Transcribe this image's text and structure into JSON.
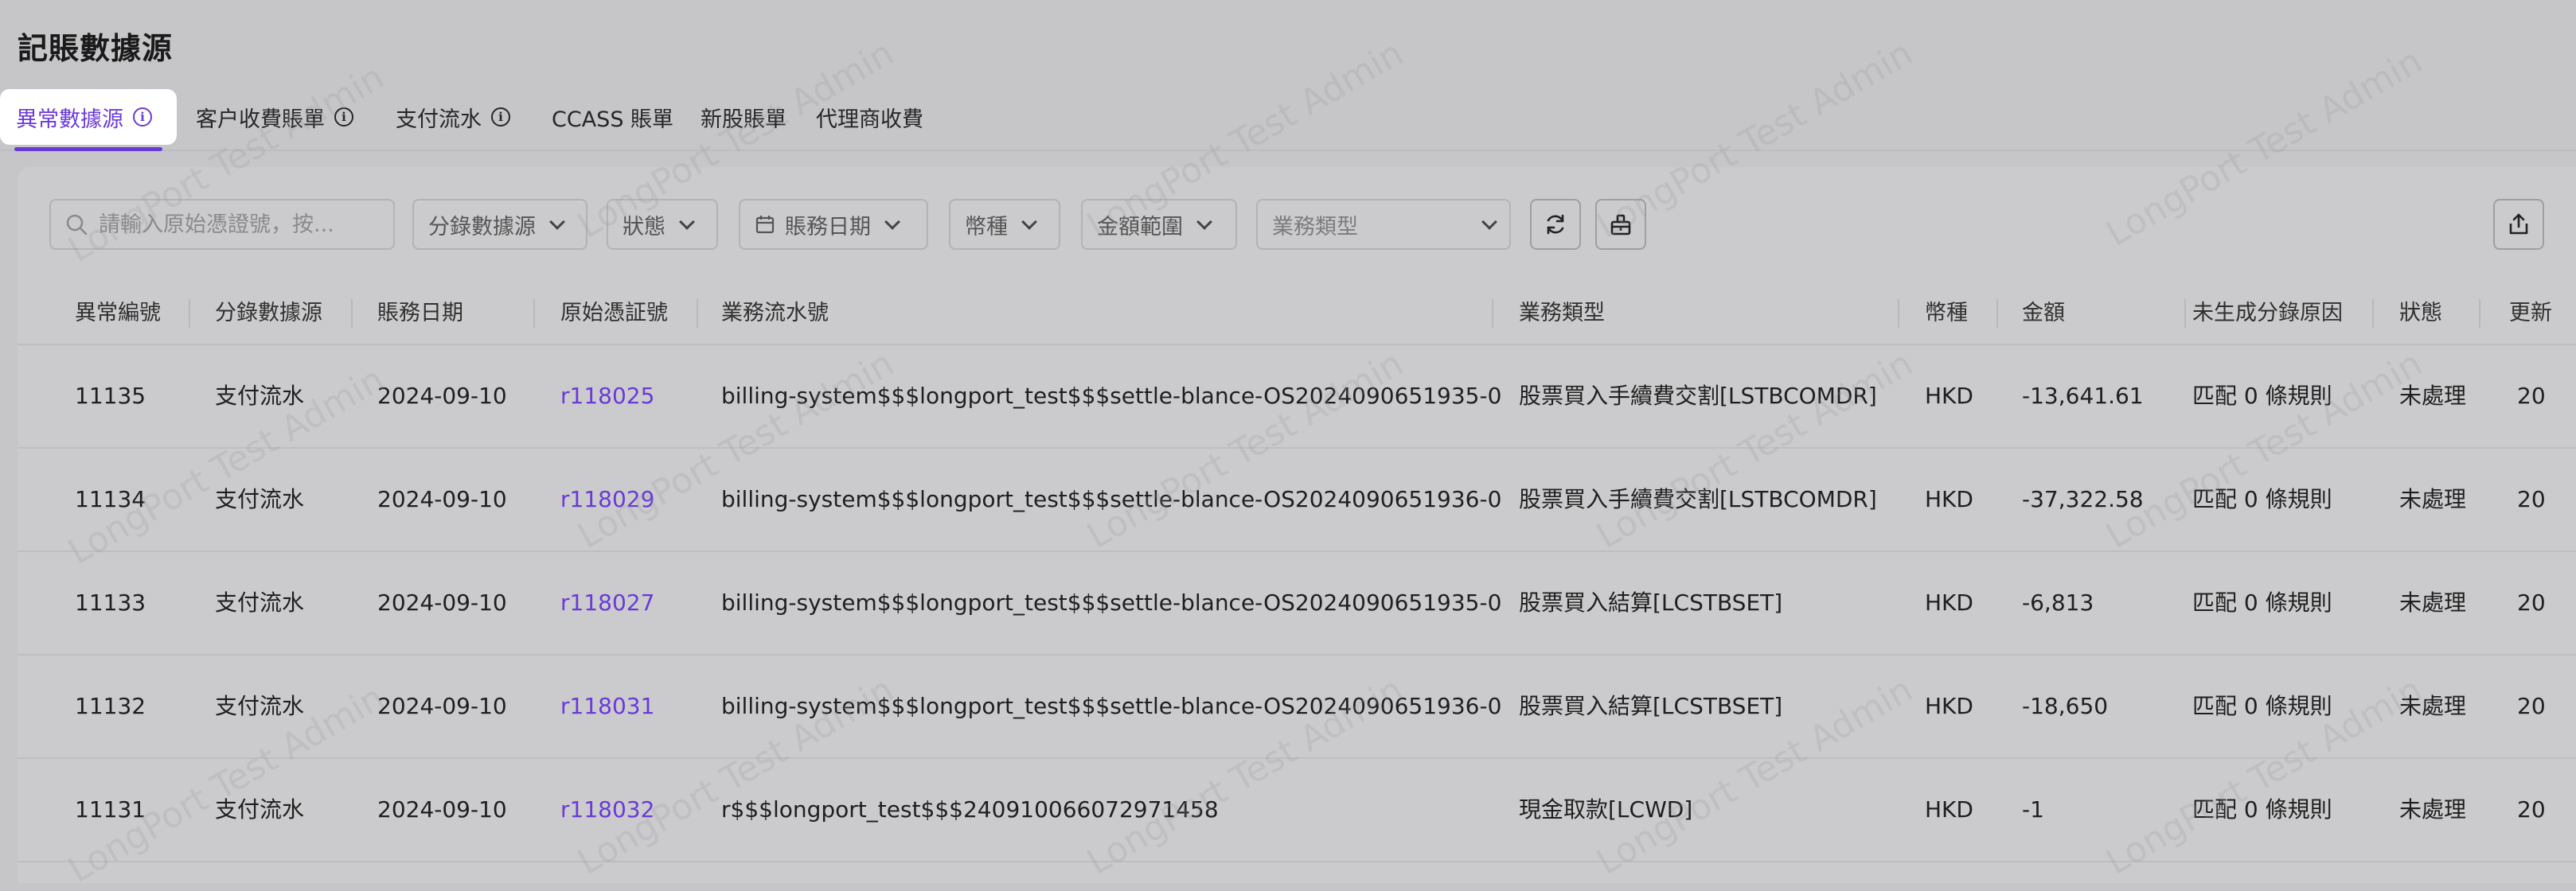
{
  "page": {
    "title": "記賬數據源"
  },
  "tabs": [
    {
      "label": "異常數據源",
      "active": true,
      "info_icon": true
    },
    {
      "label": "客户收費賬單",
      "active": false,
      "info_icon": true
    },
    {
      "label": "支付流水",
      "active": false,
      "info_icon": true
    },
    {
      "label": "CCASS 賬單",
      "active": false,
      "info_icon": false
    },
    {
      "label": "新股賬單",
      "active": false,
      "info_icon": false
    },
    {
      "label": "代理商收費",
      "active": false,
      "info_icon": false
    }
  ],
  "filters": {
    "search_placeholder": "請輸入原始憑證號，按...",
    "source": "分錄數據源",
    "status": "狀態",
    "date": "賬務日期",
    "currency": "幣種",
    "amount_range": "金額範圍",
    "business_type": "業務類型"
  },
  "table": {
    "columns": [
      "異常編號",
      "分錄數據源",
      "賬務日期",
      "原始憑証號",
      "業務流水號",
      "業務類型",
      "幣種",
      "金額",
      "未生成分錄原因",
      "狀態",
      "更新"
    ],
    "rows": [
      {
        "id": "11135",
        "source": "支付流水",
        "date": "2024-09-10",
        "voucher": "r118025",
        "flow_no": "billing-system$$$longport_test$$$settle-blance-OS2024090651935-0",
        "biz_type": "股票買入手續費交割[LSTBCOMDR]",
        "currency": "HKD",
        "amount": "-13,641.61",
        "reason": "匹配 0 條規則",
        "status": "未處理",
        "updated": "20"
      },
      {
        "id": "11134",
        "source": "支付流水",
        "date": "2024-09-10",
        "voucher": "r118029",
        "flow_no": "billing-system$$$longport_test$$$settle-blance-OS2024090651936-0",
        "biz_type": "股票買入手續費交割[LSTBCOMDR]",
        "currency": "HKD",
        "amount": "-37,322.58",
        "reason": "匹配 0 條規則",
        "status": "未處理",
        "updated": "20"
      },
      {
        "id": "11133",
        "source": "支付流水",
        "date": "2024-09-10",
        "voucher": "r118027",
        "flow_no": "billing-system$$$longport_test$$$settle-blance-OS2024090651935-0",
        "biz_type": "股票買入結算[LCSTBSET]",
        "currency": "HKD",
        "amount": "-6,813",
        "reason": "匹配 0 條規則",
        "status": "未處理",
        "updated": "20"
      },
      {
        "id": "11132",
        "source": "支付流水",
        "date": "2024-09-10",
        "voucher": "r118031",
        "flow_no": "billing-system$$$longport_test$$$settle-blance-OS2024090651936-0",
        "biz_type": "股票買入結算[LCSTBSET]",
        "currency": "HKD",
        "amount": "-18,650",
        "reason": "匹配 0 條規則",
        "status": "未處理",
        "updated": "20"
      },
      {
        "id": "11131",
        "source": "支付流水",
        "date": "2024-09-10",
        "voucher": "r118032",
        "flow_no": "r$$$longport_test$$$240910066072971458",
        "biz_type": "現金取款[LCWD]",
        "currency": "HKD",
        "amount": "-1",
        "reason": "匹配 0 條規則",
        "status": "未處理",
        "updated": "20"
      }
    ]
  },
  "watermark": "LongPort Test Admin",
  "colors": {
    "accent": "#6a3ad8",
    "overlay_bg": "#c6c6c9"
  }
}
